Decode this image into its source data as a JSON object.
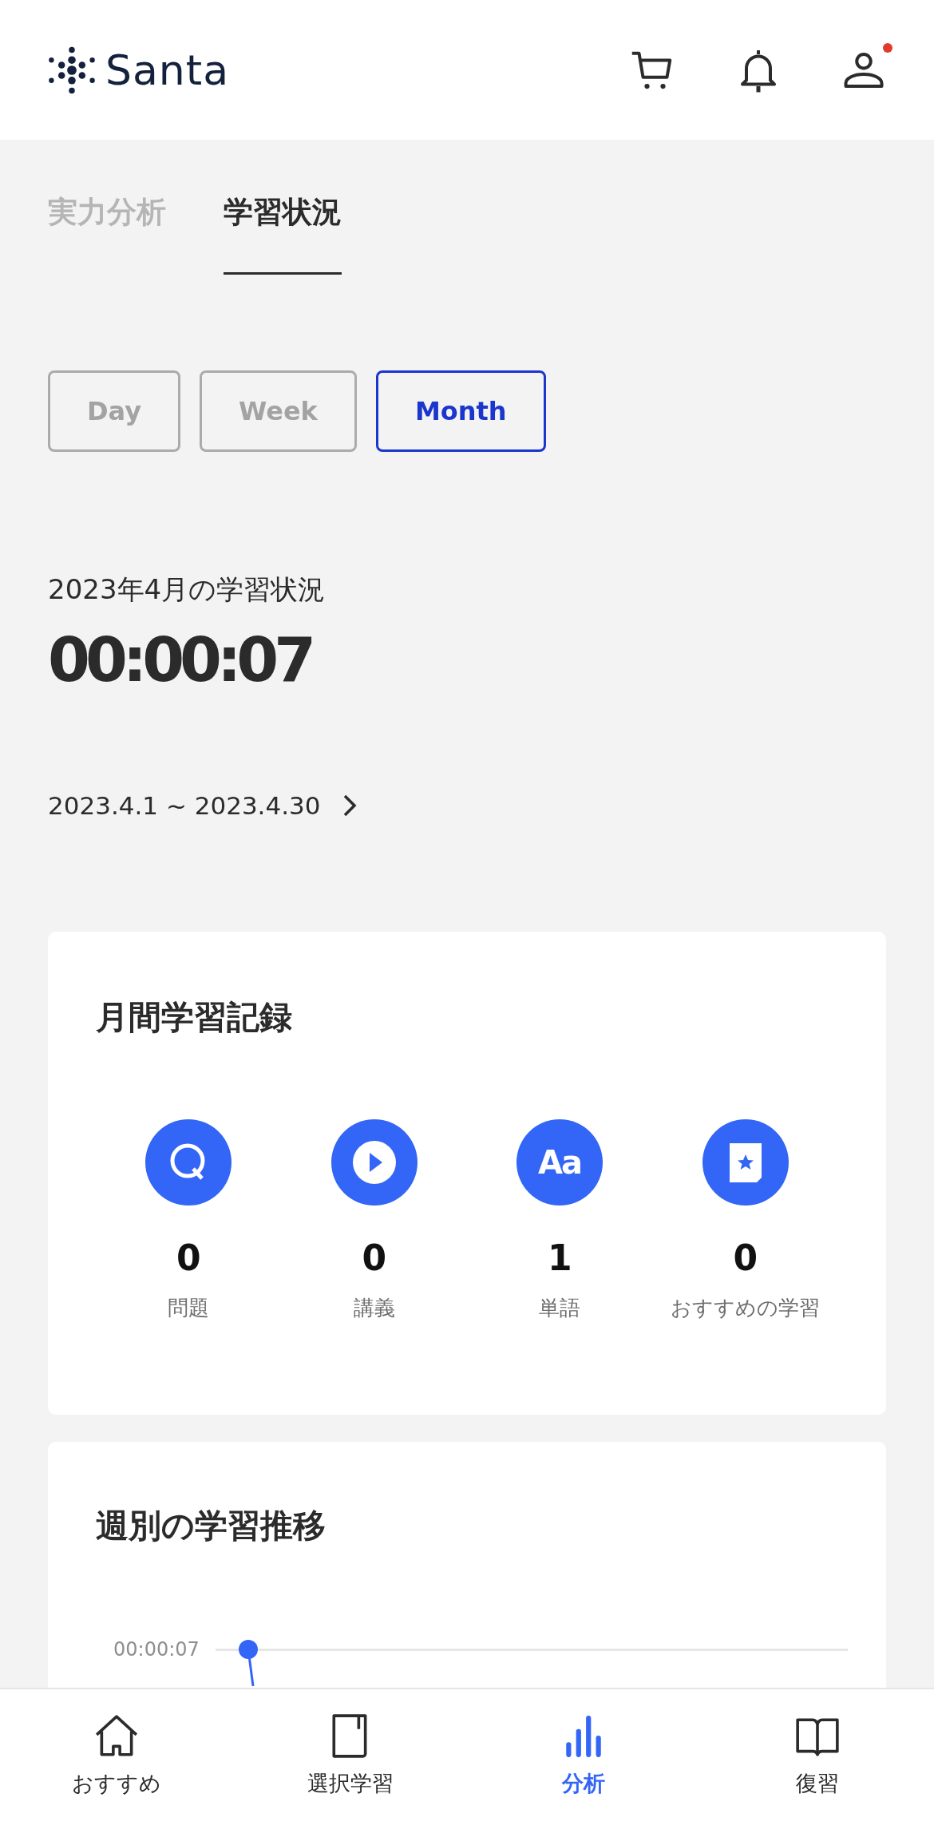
{
  "header": {
    "logo": "Santa",
    "profile_badge": true
  },
  "tabs": [
    {
      "label": "実力分析",
      "selected": false
    },
    {
      "label": "学習状況",
      "selected": true
    }
  ],
  "periods": [
    {
      "label": "Day",
      "selected": false
    },
    {
      "label": "Week",
      "selected": false
    },
    {
      "label": "Month",
      "selected": true
    }
  ],
  "summary": {
    "title": "2023年4月の学習状況",
    "total_time": "00:00:07",
    "date_range": "2023.4.1 ~ 2023.4.30"
  },
  "monthly": {
    "title": "月間学習記録",
    "stats": [
      {
        "kind": "question",
        "count": "0",
        "label": "問題"
      },
      {
        "kind": "lecture",
        "count": "0",
        "label": "講義"
      },
      {
        "kind": "vocab",
        "icon_text": "Aa",
        "count": "1",
        "label": "単語"
      },
      {
        "kind": "recommended",
        "count": "0",
        "label": "おすすめの学習"
      }
    ]
  },
  "weekly": {
    "title": "週別の学習推移",
    "y_label": "00:00:07"
  },
  "nav": [
    {
      "kind": "home",
      "label": "おすすめ",
      "selected": false
    },
    {
      "kind": "book",
      "label": "選択学習",
      "selected": false
    },
    {
      "kind": "chart",
      "label": "分析",
      "selected": true
    },
    {
      "kind": "review",
      "label": "復習",
      "selected": false
    }
  ]
}
